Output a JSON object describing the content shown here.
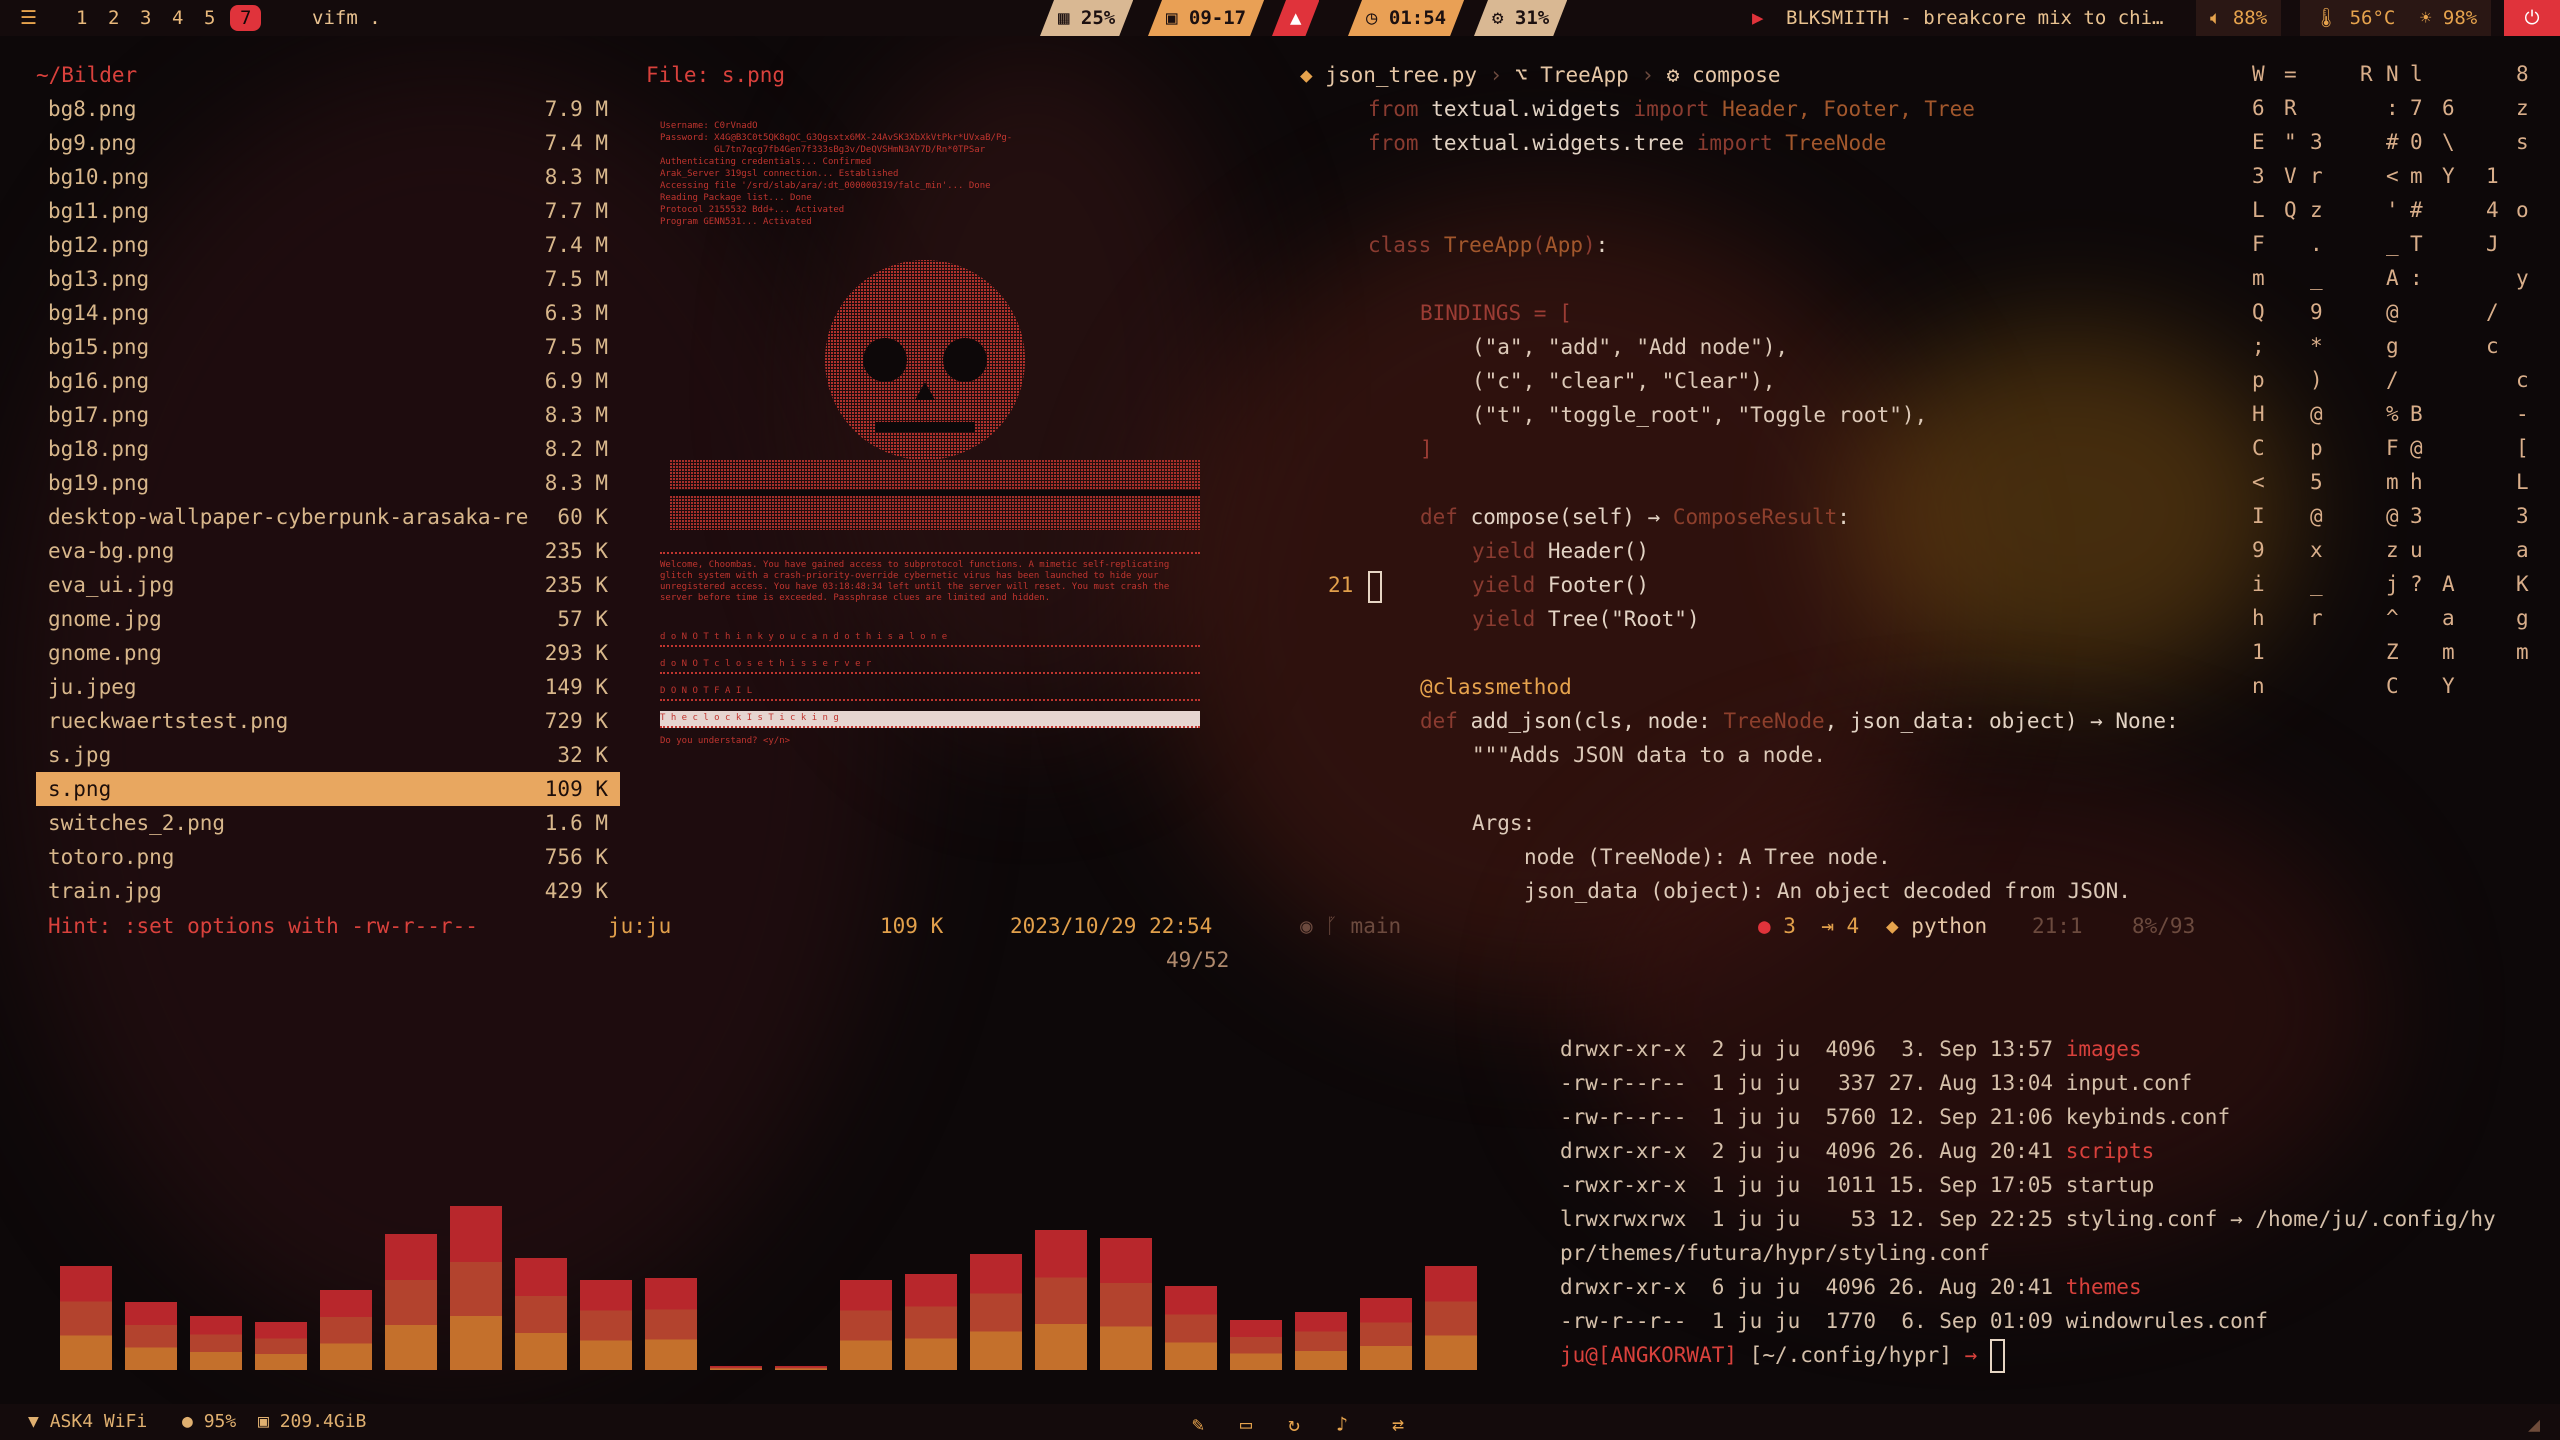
{
  "topbar": {
    "menu_icon": "menu-icon",
    "workspaces": [
      "1",
      "2",
      "3",
      "4",
      "5",
      "7"
    ],
    "active_workspace": "7",
    "window_title": "vifm .",
    "cpu": "25%",
    "date": "09-17",
    "time": "01:54",
    "gpu": "31%",
    "media": "BLKSMIITH - breakcore mix to chi…",
    "volume": "88%",
    "temperature": "56°C",
    "brightness": "98%",
    "colors": {
      "accent": "#e0333b",
      "pill": "#e9a055",
      "bg": "#140b0c"
    }
  },
  "vifm": {
    "path": "~/Bilder",
    "files": [
      {
        "name": "bg8.png",
        "size": "7.9 M"
      },
      {
        "name": "bg9.png",
        "size": "7.4 M"
      },
      {
        "name": "bg10.png",
        "size": "8.3 M"
      },
      {
        "name": "bg11.png",
        "size": "7.7 M"
      },
      {
        "name": "bg12.png",
        "size": "7.4 M"
      },
      {
        "name": "bg13.png",
        "size": "7.5 M"
      },
      {
        "name": "bg14.png",
        "size": "6.3 M"
      },
      {
        "name": "bg15.png",
        "size": "7.5 M"
      },
      {
        "name": "bg16.png",
        "size": "6.9 M"
      },
      {
        "name": "bg17.png",
        "size": "8.3 M"
      },
      {
        "name": "bg18.png",
        "size": "8.2 M"
      },
      {
        "name": "bg19.png",
        "size": "8.3 M"
      },
      {
        "name": "desktop-wallpaper-cyberpunk-arasaka-re",
        "size": "60 K"
      },
      {
        "name": "eva-bg.png",
        "size": "235 K"
      },
      {
        "name": "eva_ui.jpg",
        "size": "235 K"
      },
      {
        "name": "gnome.jpg",
        "size": "57 K"
      },
      {
        "name": "gnome.png",
        "size": "293 K"
      },
      {
        "name": "ju.jpeg",
        "size": "149 K"
      },
      {
        "name": "rueckwaertstest.png",
        "size": "729 K"
      },
      {
        "name": "s.jpg",
        "size": "32 K"
      },
      {
        "name": "s.png",
        "size": "109 K"
      },
      {
        "name": "switches_2.png",
        "size": "1.6 M"
      },
      {
        "name": "totoro.png",
        "size": "756 K"
      },
      {
        "name": "train.jpg",
        "size": "429 K"
      }
    ],
    "selected_index": 20,
    "preview_title": "File: s.png",
    "hint": "Hint: :set options with -rw-r--r--",
    "owner": "ju:ju",
    "sel_size": "109 K",
    "mtime": "2023/10/29 22:54",
    "position": "49/52"
  },
  "preview": {
    "header_lines": [
      "Username: C0rVnadO",
      "Password: X4G@B3C0t5QK8qQC_G3Qgsxtx6MX-24AvSK3XbXkVtPkr*UVxaB/Pg-",
      "          GL7tn7qcg7fb4Gen7f333sBg3v/DeQVSHmN3AY7D/Rn*0TPSar",
      "Authenticating credentials... Confirmed",
      "Arak_Server 319gsl connection... Established",
      "Accessing file '/srd/slab/ara/:dt_000000319/falc_min'... Done",
      "Reading Package list... Done",
      "Protocol 2155532 Bdd+... Activated",
      "Program GENN531... Activated"
    ],
    "message": "Welcome, Choombas. You have gained access to subprotocol functions. A mimetic self-replicating glitch system with a crash-priority-override cybernetic virus has been launched to hide your unregistered access. You have 03:18:48:34 left until the server will reset. You must crash the server before time is exceeded. Passphrase clues are limited and hidden.",
    "clues": [
      "doNOTthinkyoucandothisalone",
      "doNOTclosethisserver",
      "DONOTFAIL",
      "TheclockIsTicking"
    ],
    "prompt": "Do you understand? <y/n>"
  },
  "editor": {
    "breadcrumb": [
      "json_tree.py",
      "TreeApp",
      "compose"
    ],
    "current_line": "21",
    "status": {
      "errors": "3",
      "warnings": "4",
      "lang": "python",
      "pos": "21:1",
      "pct": "8%/93",
      "branch": "main"
    }
  },
  "matrix_cols": [
    [
      "W",
      "6",
      "E",
      "3",
      "L",
      "F",
      "m",
      "Q",
      ";",
      "p",
      "H",
      "C",
      "<",
      "I",
      "9",
      "i",
      "h",
      "1",
      "n"
    ],
    [
      "=",
      "R",
      "\"",
      "V",
      "Q",
      "",
      "",
      "",
      "",
      "",
      "",
      "",
      "",
      "",
      "",
      "",
      "",
      "",
      ""
    ],
    [
      "",
      "",
      "3",
      "r",
      "z",
      ".",
      "_",
      "9",
      "*",
      ")",
      "@",
      "p",
      "5",
      "@",
      "x",
      "_",
      "r",
      "",
      ""
    ],
    [
      "R",
      "",
      "",
      "",
      "",
      "",
      "",
      "",
      "",
      "",
      "",
      "",
      "",
      "",
      "",
      "",
      "",
      "",
      ""
    ],
    [
      "N",
      ":",
      "#",
      "<",
      "'",
      "_",
      "A",
      "@",
      "g",
      "/",
      "%",
      "F",
      "m",
      "@",
      "z",
      "j",
      "^",
      "Z",
      "C"
    ],
    [
      "l",
      "7",
      "0",
      "m",
      "#",
      "T",
      ":",
      "",
      "",
      "",
      "B",
      "@",
      "h",
      "3",
      "u",
      "?",
      "",
      "",
      ""
    ],
    [
      "",
      "6",
      "\\",
      "Y",
      "",
      "",
      "",
      "",
      "",
      "",
      "",
      "",
      "",
      "",
      "",
      "A",
      "a",
      "m",
      "Y"
    ],
    [
      "",
      "",
      "",
      "1",
      "4",
      "J",
      "",
      "/",
      "c",
      "",
      "",
      "",
      "",
      "",
      "",
      "",
      "",
      "",
      ""
    ],
    [
      "8",
      "z",
      "s",
      "",
      "o",
      "",
      "y",
      "",
      "",
      "c",
      "-",
      "[",
      "L",
      "3",
      "a",
      "K",
      "g",
      "m",
      ""
    ]
  ],
  "ls": [
    {
      "perm": "drwxr-xr-x",
      "n": "2",
      "u": "ju",
      "g": "ju",
      "sz": "4096",
      "d": "3.",
      "m": "Sep",
      "t": "13:57",
      "name": "images",
      "dir": true
    },
    {
      "perm": "-rw-r--r--",
      "n": "1",
      "u": "ju",
      "g": "ju",
      "sz": "337",
      "d": "27.",
      "m": "Aug",
      "t": "13:04",
      "name": "input.conf",
      "dir": false
    },
    {
      "perm": "-rw-r--r--",
      "n": "1",
      "u": "ju",
      "g": "ju",
      "sz": "5760",
      "d": "12.",
      "m": "Sep",
      "t": "21:06",
      "name": "keybinds.conf",
      "dir": false
    },
    {
      "perm": "drwxr-xr-x",
      "n": "2",
      "u": "ju",
      "g": "ju",
      "sz": "4096",
      "d": "26.",
      "m": "Aug",
      "t": "20:41",
      "name": "scripts",
      "dir": true
    },
    {
      "perm": "-rwxr-xr-x",
      "n": "1",
      "u": "ju",
      "g": "ju",
      "sz": "1011",
      "d": "15.",
      "m": "Sep",
      "t": "17:05",
      "name": "startup",
      "dir": false
    },
    {
      "perm": "lrwxrwxrwx",
      "n": "1",
      "u": "ju",
      "g": "ju",
      "sz": "53",
      "d": "12.",
      "m": "Sep",
      "t": "22:25",
      "name": "styling.conf → /home/ju/.config/hy",
      "dir": false
    },
    {
      "perm": "",
      "n": "",
      "u": "",
      "g": "",
      "sz": "",
      "d": "",
      "m": "",
      "t": "",
      "name": "pr/themes/futura/hypr/styling.conf",
      "dir": false
    },
    {
      "perm": "drwxr-xr-x",
      "n": "6",
      "u": "ju",
      "g": "ju",
      "sz": "4096",
      "d": "26.",
      "m": "Aug",
      "t": "20:41",
      "name": "themes",
      "dir": true
    },
    {
      "perm": "-rw-r--r--",
      "n": "1",
      "u": "ju",
      "g": "ju",
      "sz": "1770",
      "d": "6.",
      "m": "Sep",
      "t": "01:09",
      "name": "windowrules.conf",
      "dir": false
    }
  ],
  "prompt": {
    "user": "ju@[ANGKORWAT]",
    "cwd": "[~/.config/hypr]",
    "arrow": "→"
  },
  "visualizer_levels": [
    0.52,
    0.34,
    0.27,
    0.24,
    0.4,
    0.68,
    0.82,
    0.56,
    0.45,
    0.46,
    0.01,
    0.01,
    0.45,
    0.48,
    0.58,
    0.7,
    0.66,
    0.42,
    0.25,
    0.29,
    0.36,
    0.52
  ],
  "bottombar": {
    "wifi": "ASK4 WiFi",
    "battery": "95%",
    "disk": "209.4GiB",
    "tray_icons": [
      "pen-icon",
      "monitor-icon",
      "refresh-icon",
      "bell-icon",
      "network-icon"
    ]
  }
}
